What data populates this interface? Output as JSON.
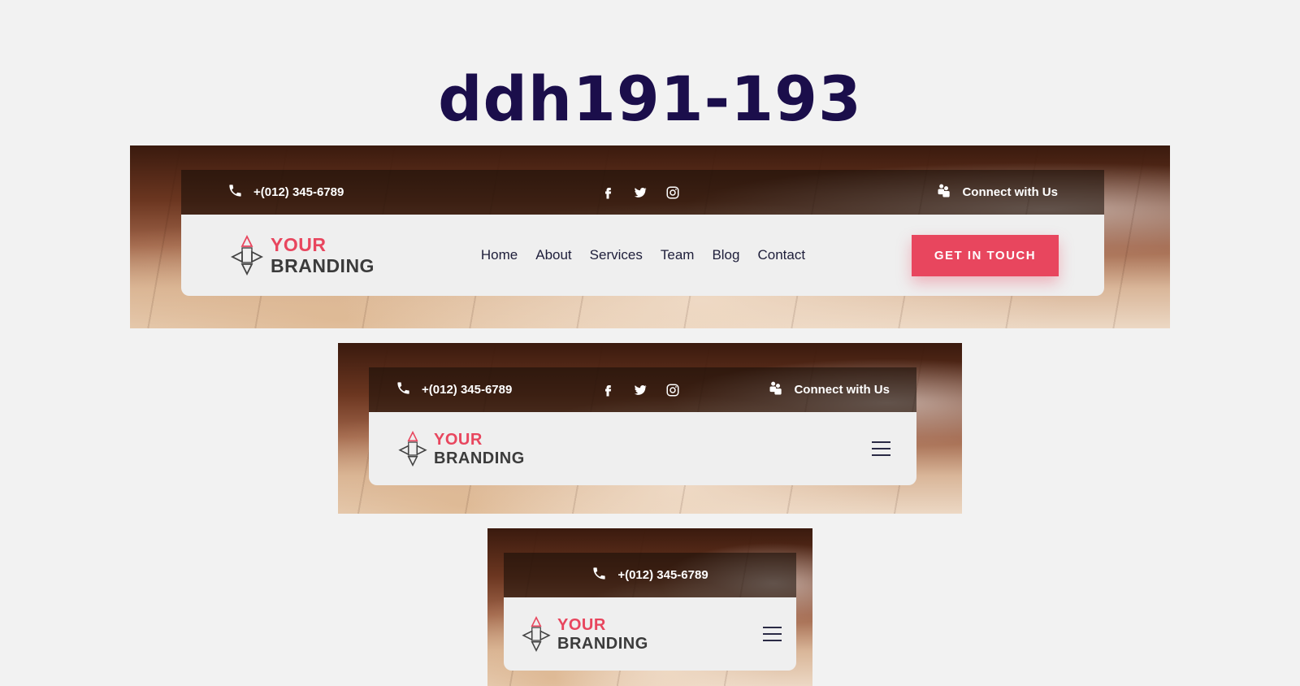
{
  "page": {
    "title": "ddh191-193"
  },
  "topbar": {
    "phone": "+(012) 345-6789",
    "connect": "Connect with Us",
    "social_icons": [
      "facebook-icon",
      "twitter-icon",
      "instagram-icon"
    ]
  },
  "logo": {
    "line1": "YOUR",
    "line2": "BRANDING"
  },
  "nav": {
    "items": [
      "Home",
      "About",
      "Services",
      "Team",
      "Blog",
      "Contact"
    ]
  },
  "cta": {
    "label": "GET IN TOUCH"
  },
  "colors": {
    "accent": "#e8465e",
    "title": "#1b0e4b",
    "nav_text": "#1e1e3a",
    "header_bg": "#efefef"
  }
}
